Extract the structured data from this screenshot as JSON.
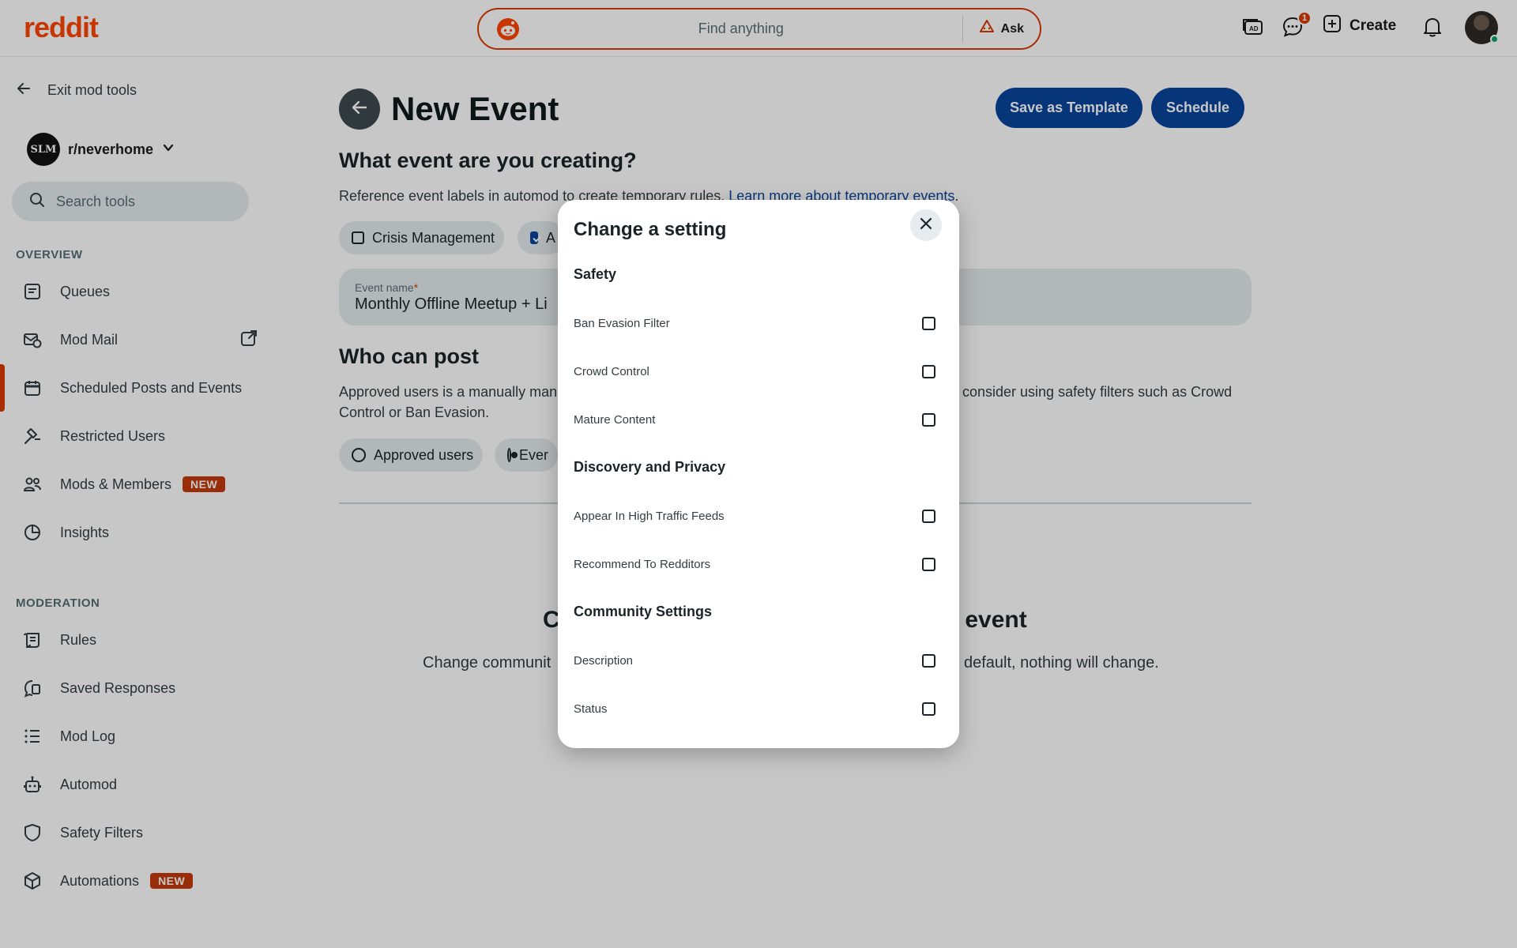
{
  "header": {
    "logo": "reddit",
    "search_placeholder": "Find anything",
    "ask_label": "Ask",
    "chat_badge": "1",
    "create_label": "Create"
  },
  "sidebar": {
    "exit_label": "Exit mod tools",
    "community_name": "r/neverhome",
    "community_avatar_text": "SLM",
    "search_placeholder": "Search tools",
    "overview_label": "OVERVIEW",
    "overview_items": [
      {
        "label": "Queues",
        "icon": "queue-icon"
      },
      {
        "label": "Mod Mail",
        "icon": "mod-mail-icon"
      },
      {
        "label": "Scheduled Posts and Events",
        "icon": "calendar-icon"
      },
      {
        "label": "Restricted Users",
        "icon": "hammer-icon"
      },
      {
        "label": "Mods & Members",
        "icon": "members-icon",
        "tag": "NEW"
      },
      {
        "label": "Insights",
        "icon": "chart-icon"
      }
    ],
    "moderation_label": "MODERATION",
    "moderation_items": [
      {
        "label": "Rules",
        "icon": "rules-icon"
      },
      {
        "label": "Saved Responses",
        "icon": "saved-responses-icon"
      },
      {
        "label": "Mod Log",
        "icon": "list-icon"
      },
      {
        "label": "Automod",
        "icon": "robot-icon"
      },
      {
        "label": "Safety Filters",
        "icon": "shield-icon"
      },
      {
        "label": "Automations",
        "icon": "box-icon",
        "tag": "NEW"
      }
    ]
  },
  "main": {
    "title": "New Event",
    "save_template_label": "Save as Template",
    "schedule_label": "Schedule",
    "event_heading": "What event are you creating?",
    "event_desc": "Reference event labels in automod to create temporary rules. ",
    "event_link": "Learn more about temporary events",
    "event_desc_end": ".",
    "chips": [
      {
        "label": "Crisis Management",
        "checked": false
      },
      {
        "label": "A",
        "checked": true
      }
    ],
    "event_name_label": "Event name",
    "event_name_required": "*",
    "event_name_value": "Monthly Offline Meetup + Li",
    "who_heading": "Who can post",
    "who_desc_left": "Approved users is a manually man",
    "who_desc_right": "consider using safety filters such as Crowd",
    "who_desc_line2": "Control or Ban Evasion.",
    "radios": [
      {
        "label": "Approved users",
        "selected": false
      },
      {
        "label": "Ever",
        "selected": true
      }
    ],
    "settings_heading_left": "C",
    "settings_heading_right": "ne event",
    "settings_desc_left": "Change communit",
    "settings_desc_right": "default, nothing will change."
  },
  "modal": {
    "title": "Change a setting",
    "sections": [
      {
        "title": "Safety",
        "items": [
          "Ban Evasion Filter",
          "Crowd Control",
          "Mature Content"
        ]
      },
      {
        "title": "Discovery and Privacy",
        "items": [
          "Appear In High Traffic Feeds",
          "Recommend To Redditors"
        ]
      },
      {
        "title": "Community Settings",
        "items": [
          "Description",
          "Status"
        ]
      }
    ]
  },
  "colors": {
    "brand": "#ff4500",
    "primary_button": "#0a449b",
    "active_indicator": "#d93a00",
    "new_tag": "#c63a0c"
  }
}
